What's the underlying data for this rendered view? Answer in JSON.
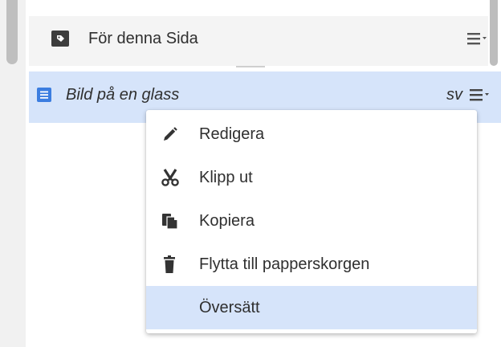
{
  "section": {
    "title": "För denna Sida",
    "icon": "tag-icon",
    "menu_icon": "list-menu-icon"
  },
  "item": {
    "title": "Bild på en glass",
    "language": "sv",
    "icon": "document-icon",
    "menu_icon": "list-menu-icon"
  },
  "context_menu": {
    "items": [
      {
        "label": "Redigera",
        "icon": "pencil-icon"
      },
      {
        "label": "Klipp ut",
        "icon": "scissors-icon"
      },
      {
        "label": "Kopiera",
        "icon": "copy-icon"
      },
      {
        "label": "Flytta till papperskorgen",
        "icon": "trash-icon"
      },
      {
        "label": "Översätt",
        "icon": "",
        "selected": true
      }
    ]
  },
  "colors": {
    "highlight": "#d6e4fa",
    "accent_icon": "#3b7de0",
    "text": "#2f2f2f",
    "header_bg": "#f4f4f4"
  }
}
